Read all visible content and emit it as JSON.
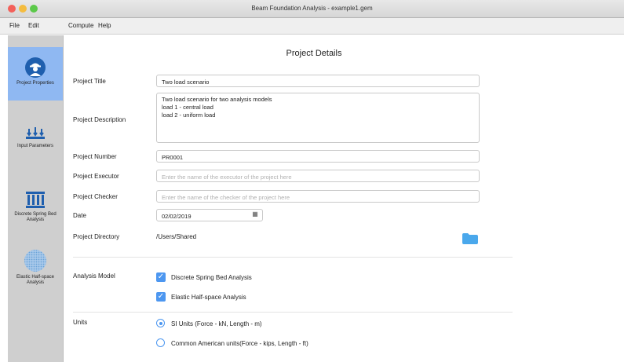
{
  "window": {
    "title": "Beam Foundation Analysis - example1.gem"
  },
  "menu": [
    "File",
    "Edit",
    "Compute",
    "Help"
  ],
  "sidebar": {
    "items": [
      {
        "label": "Project Properties",
        "icon": "engineer-icon",
        "active": true
      },
      {
        "label": "Input Parameters",
        "icon": "load-arrows-icon",
        "active": false
      },
      {
        "label": "Discrete Spring Bed Analysis",
        "icon": "spring-bed-icon",
        "active": false
      },
      {
        "label": "Elastic Half-space Analysis",
        "icon": "half-space-icon",
        "active": false
      }
    ]
  },
  "page": {
    "heading": "Project Details"
  },
  "form": {
    "title_label": "Project Title",
    "title_value": "Two load scenario",
    "description_label": "Project Description",
    "description_lines": [
      "Two load scenario for two analysis models",
      "load 1 - central load",
      "load 2 - uniform load"
    ],
    "number_label": "Project Number",
    "number_value": "PR0001",
    "executor_label": "Project Executor",
    "executor_placeholder": "Enter the name of the executor of the project here",
    "checker_label": "Project Checker",
    "checker_placeholder": "Enter the name of the checker of the project here",
    "date_label": "Date",
    "date_value": "02/02/2019",
    "directory_label": "Project Directory",
    "directory_value": "/Users/Shared"
  },
  "analysis": {
    "label": "Analysis Model",
    "options": [
      {
        "label": "Discrete Spring Bed Analysis",
        "checked": true
      },
      {
        "label": "Elastic Half-space Analysis",
        "checked": true
      }
    ]
  },
  "units": {
    "label": "Units",
    "options": [
      {
        "label": "SI Units (Force - kN, Length - m)",
        "selected": true
      },
      {
        "label": "Common American units(Force - kips, Length - ft)",
        "selected": false
      }
    ]
  },
  "colors": {
    "accent": "#4d97f0",
    "sidebar_active": "#8fb8f2",
    "sidebar_bg": "#cfcfcf"
  }
}
